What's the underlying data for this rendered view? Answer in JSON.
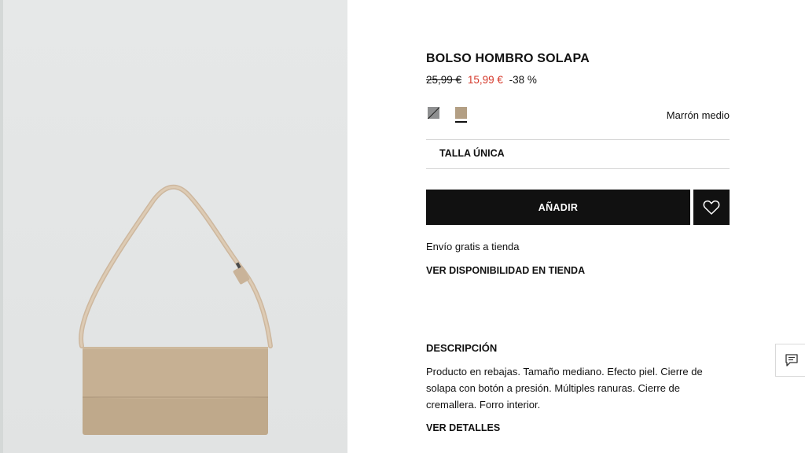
{
  "product": {
    "title": "BOLSO HOMBRO SOLAPA",
    "old_price": "25,99 €",
    "sale_price": "15,99 €",
    "discount": "-38 %",
    "color_name": "Marrón medio",
    "size_label": "TALLA ÚNICA",
    "add_button": "AÑADIR",
    "shipping": "Envío gratis a tienda",
    "availability_link": "VER DISPONIBILIDAD EN TIENDA",
    "description_title": "DESCRIPCIÓN",
    "description": "Producto en rebajas. Tamaño mediano. Efecto piel. Cierre de solapa con botón a presión. Múltiples ranuras. Cierre de cremallera. Forro interior.",
    "details_link": "VER DETALLES"
  },
  "swatches": [
    {
      "name": "grey-swatch",
      "color": "#8e8f90"
    },
    {
      "name": "tan-swatch",
      "color": "#b39f84",
      "selected": true
    }
  ],
  "colors": {
    "sale": "#d53a2c",
    "button": "#111111",
    "image_bg": "#e4e6e6"
  },
  "icons": {
    "favorite": "heart-icon",
    "chat": "chat-icon"
  }
}
